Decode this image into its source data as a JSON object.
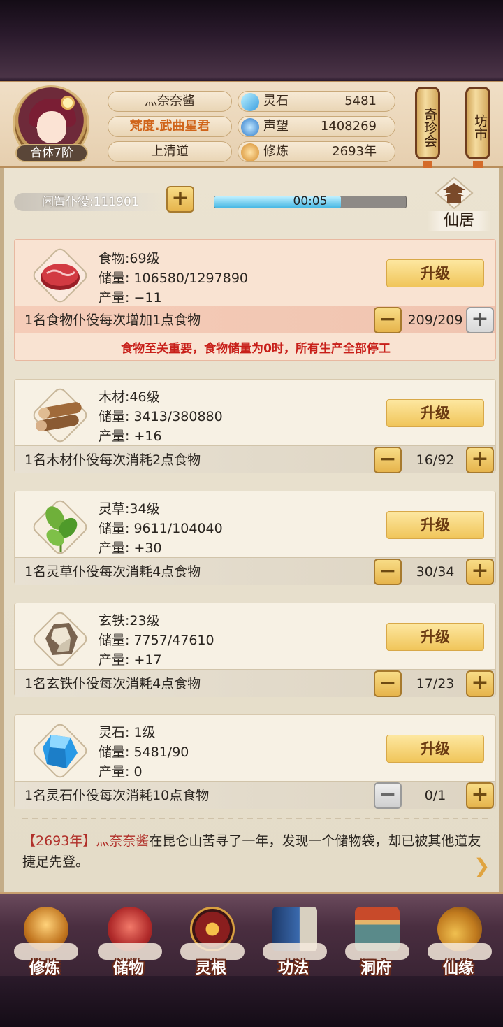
{
  "profile": {
    "name": "灬奈奈酱",
    "title": "梵度.武曲星君",
    "sect": "上清道",
    "realm": "合体7阶"
  },
  "stats": [
    {
      "label": "灵石",
      "value": "5481",
      "icon": "spirit-stone-icon"
    },
    {
      "label": "声望",
      "value": "1408269",
      "icon": "reputation-icon"
    },
    {
      "label": "修炼",
      "value": "2693年",
      "icon": "cultivation-icon"
    }
  ],
  "lanterns": [
    "奇珍会",
    "坊市"
  ],
  "idle_servants": "闲置仆役:111901",
  "timer": {
    "text": "00:05",
    "progress": 0.66
  },
  "residence_label": "仙居",
  "resources": [
    {
      "name": "食物:69级",
      "storage": "储量: 106580/1297890",
      "output": "产量: −11",
      "upgrade": "升级",
      "rule": "1名食物仆役每次增加1点食物",
      "count": "209/209",
      "warning": "食物至关重要，食物储量为0时，所有生产全部停工"
    },
    {
      "name": "木材:46级",
      "storage": "储量: 3413/380880",
      "output": "产量: +16",
      "upgrade": "升级",
      "rule": "1名木材仆役每次消耗2点食物",
      "count": "16/92"
    },
    {
      "name": "灵草:34级",
      "storage": "储量: 9611/104040",
      "output": "产量: +30",
      "upgrade": "升级",
      "rule": "1名灵草仆役每次消耗4点食物",
      "count": "30/34"
    },
    {
      "name": "玄铁:23级",
      "storage": "储量: 7757/47610",
      "output": "产量: +17",
      "upgrade": "升级",
      "rule": "1名玄铁仆役每次消耗4点食物",
      "count": "17/23"
    },
    {
      "name": "灵石: 1级",
      "storage": "储量: 5481/90",
      "output": "产量: 0",
      "upgrade": "升级",
      "rule": "1名灵石仆役每次消耗10点食物",
      "count": "0/1"
    }
  ],
  "log": {
    "year": "【2693年】",
    "name": "灬奈奈酱",
    "text": "在昆仑山苦寻了一年，发现一个储物袋，却已被其他道友捷足先登。"
  },
  "nav": [
    "修炼",
    "储物",
    "灵根",
    "功法",
    "洞府",
    "仙缘"
  ],
  "colors": {
    "accent_gold": "#f0c55a",
    "warning_red": "#c8201a",
    "log_red": "#b0302a"
  }
}
